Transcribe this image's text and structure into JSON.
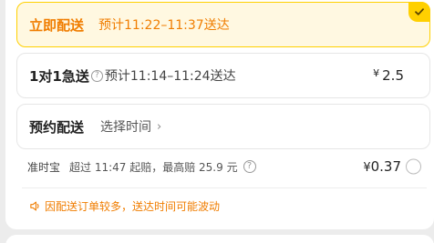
{
  "delivery_options": {
    "instant": {
      "label": "立即配送",
      "eta": "预计11:22–11:37送达"
    },
    "express": {
      "label": "1对1急送",
      "help": "?",
      "eta": "预计11:14–11:24送达",
      "currency": "¥",
      "price": "2.5"
    },
    "scheduled": {
      "label": "预约配送",
      "pick_time": "选择时间",
      "chevron": "›"
    }
  },
  "insurance": {
    "name": "准时宝",
    "description": "超过 11:47 起赔，最高赔 25.9 元",
    "help": "?",
    "currency": "¥",
    "price": "0.37"
  },
  "notice": {
    "text": "因配送订单较多，送达时间可能波动"
  },
  "colors": {
    "accent_orange": "#f07d00",
    "accent_yellow": "#ffd000",
    "selected_bg": "#fff8e1"
  },
  "icons": {
    "selected": "check-icon",
    "help": "question-circle-icon",
    "speaker": "speaker-icon",
    "chevron": "chevron-right-icon"
  }
}
